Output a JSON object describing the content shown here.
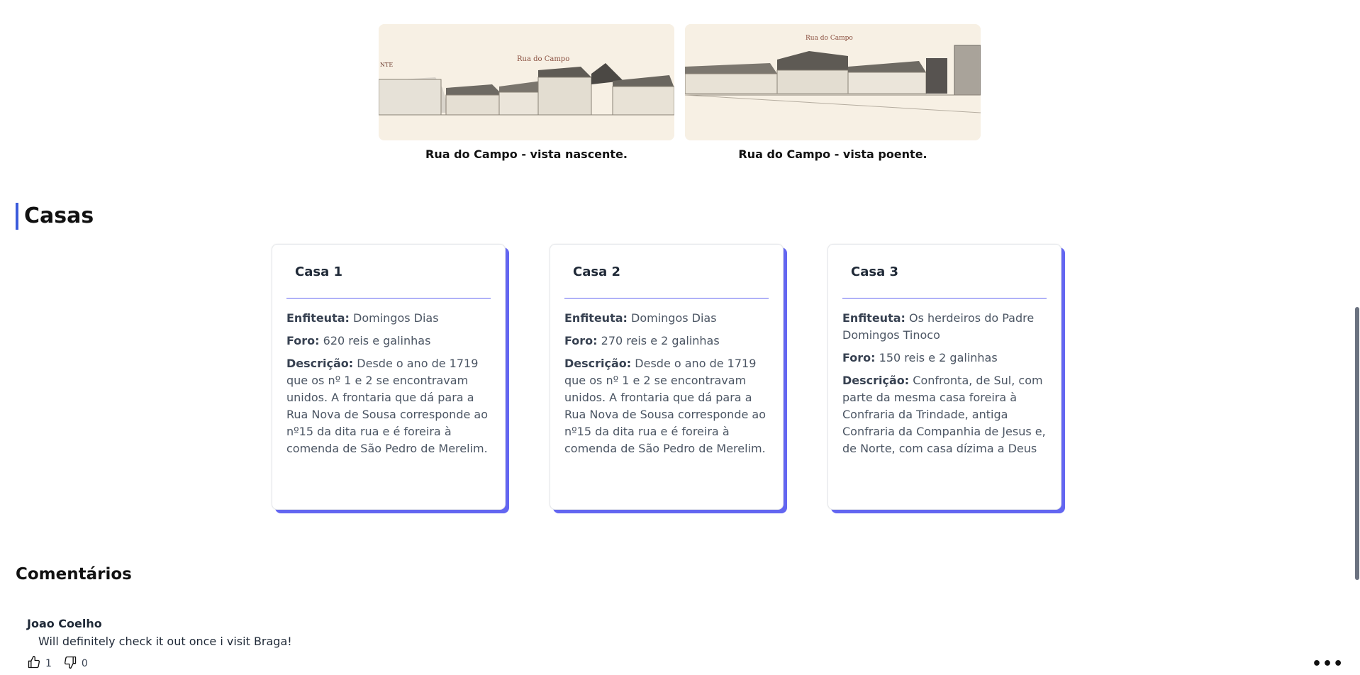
{
  "figures": [
    {
      "image_text": "Rua do Campo",
      "side_text": "NTE",
      "caption": "Rua do Campo - vista nascente."
    },
    {
      "image_text": "Rua do Campo",
      "caption": "Rua do Campo - vista poente."
    }
  ],
  "section_title": "Casas",
  "cards": [
    {
      "title": "Casa 1",
      "enfiteuta_label": "Enfiteuta:",
      "enfiteuta": "Domingos Dias",
      "foro_label": "Foro:",
      "foro": "620 reis e galinhas",
      "descricao_label": "Descrição:",
      "descricao": "Desde o ano de 1719 que os nº 1 e 2 se encontravam unidos. A frontaria que dá para a Rua Nova de Sousa corresponde ao nº15 da dita rua e é foreira à comenda de São Pedro de Merelim."
    },
    {
      "title": "Casa 2",
      "enfiteuta_label": "Enfiteuta:",
      "enfiteuta": "Domingos Dias",
      "foro_label": "Foro:",
      "foro": "270 reis e 2 galinhas",
      "descricao_label": "Descrição:",
      "descricao": "Desde o ano de 1719 que os nº 1 e 2 se encontravam unidos. A frontaria que dá para a Rua Nova de Sousa corresponde ao nº15 da dita rua e é foreira à comenda de São Pedro de Merelim."
    },
    {
      "title": "Casa 3",
      "enfiteuta_label": "Enfiteuta:",
      "enfiteuta": "Os herdeiros do Padre Domingos Tinoco",
      "foro_label": "Foro:",
      "foro": "150 reis e 2 galinhas",
      "descricao_label": "Descrição:",
      "descricao": "Confronta, de Sul, com parte da mesma casa foreira à Confraria da Trindade, antiga Confraria da Companhia de Jesus e, de Norte, com casa dízima a Deus"
    }
  ],
  "comments_title": "Comentários",
  "comment": {
    "author": "Joao Coelho",
    "text": "Will definitely check it out once i visit Braga!",
    "likes": "1",
    "dislikes": "0",
    "more_icon": "more-horizontal-icon"
  },
  "colors": {
    "accent": "#6366f1",
    "title_bar": "#3b5bdb"
  }
}
